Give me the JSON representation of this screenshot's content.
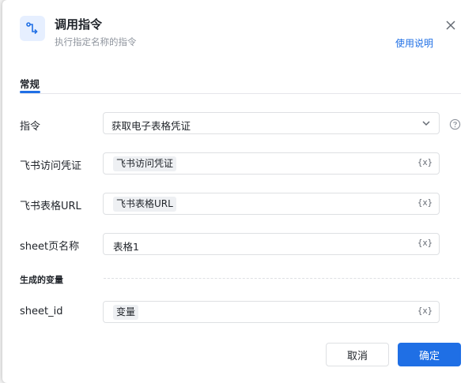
{
  "dialog": {
    "title": "调用指令",
    "subtitle": "执行指定名称的指令",
    "help_link": "使用说明",
    "icon": "branch-arrow-icon"
  },
  "tabs": [
    {
      "label": "常规",
      "active": true
    }
  ],
  "form": {
    "command": {
      "label": "指令",
      "value": "获取电子表格凭证"
    },
    "credential": {
      "label": "飞书访问凭证",
      "value": "飞书访问凭证",
      "var_button": "{x}"
    },
    "sheet_url": {
      "label": "飞书表格URL",
      "value": "飞书表格URL",
      "var_button": "{x}"
    },
    "sheet_name": {
      "label": "sheet页名称",
      "value": "表格1",
      "var_button": "{x}"
    }
  },
  "output": {
    "section_title": "生成的变量",
    "sheet_id": {
      "label": "sheet_id",
      "value": "变量",
      "var_button": "{x}"
    }
  },
  "footer": {
    "cancel_label": "取消",
    "ok_label": "确定"
  },
  "colors": {
    "accent": "#1f6fe5",
    "text": "#1f2329",
    "muted": "#8f959e",
    "border": "#dee0e3"
  }
}
